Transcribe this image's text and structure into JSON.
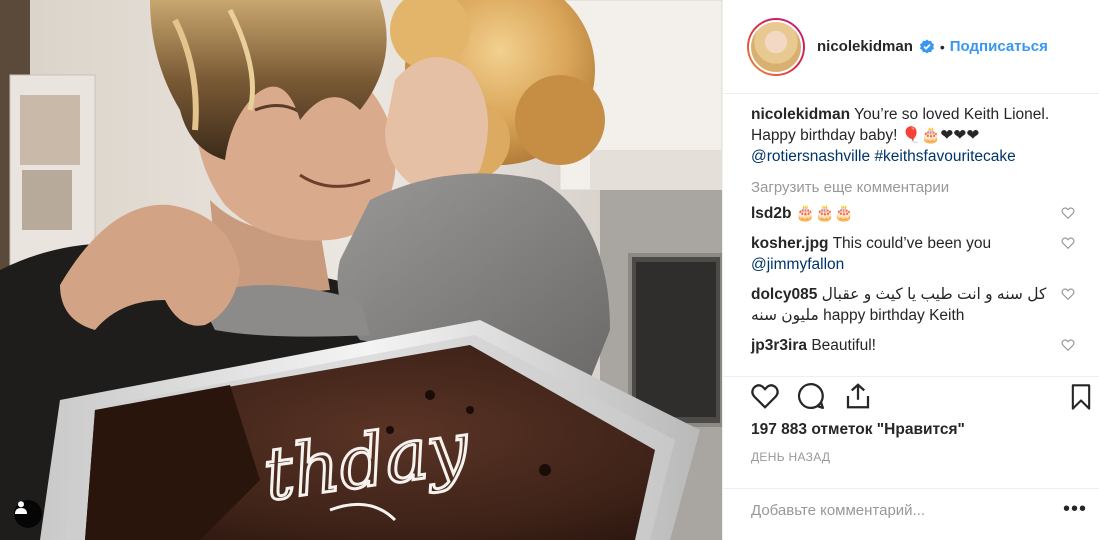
{
  "post": {
    "username": "nicolekidman",
    "follow_label": "Подписаться",
    "separator": "•",
    "caption_text": "You’re so loved Keith Lionel. Happy birthday baby! 🎈🎂❤❤❤",
    "caption_mention": "@rotiersnashville",
    "caption_hashtag": "#keithsfavouritecake",
    "load_more": "Загрузить еще комментарии",
    "likes": "197 883 отметок \"Нравится\"",
    "date": "ДЕНЬ НАЗАД",
    "add_comment_placeholder": "Добавьте комментарий...",
    "more_label": "•••"
  },
  "comments": [
    {
      "user": "lsd2b",
      "text": "🎂🎂🎂"
    },
    {
      "user": "kosher.jpg",
      "text": "This could’ve been you",
      "mention": "@jimmyfallon"
    },
    {
      "user": "dolcy085",
      "text_rtl_1": "كل سنه و انت طيب يا كيث و عقبال",
      "text_rtl_2": "مليون سنه",
      "text": "happy birthday Keith"
    },
    {
      "user": "jp3r3ira",
      "text": "Beautiful!"
    }
  ],
  "photo": {
    "cake_writing": "thday"
  },
  "icons": {
    "verified": "verified-badge-icon",
    "like": "heart-icon",
    "comment": "comment-bubble-icon",
    "share": "share-icon",
    "save": "bookmark-icon",
    "tag": "user-tag-icon"
  },
  "colors": {
    "link": "#003569",
    "follow": "#3897f0",
    "muted": "#999999",
    "text": "#262626"
  }
}
